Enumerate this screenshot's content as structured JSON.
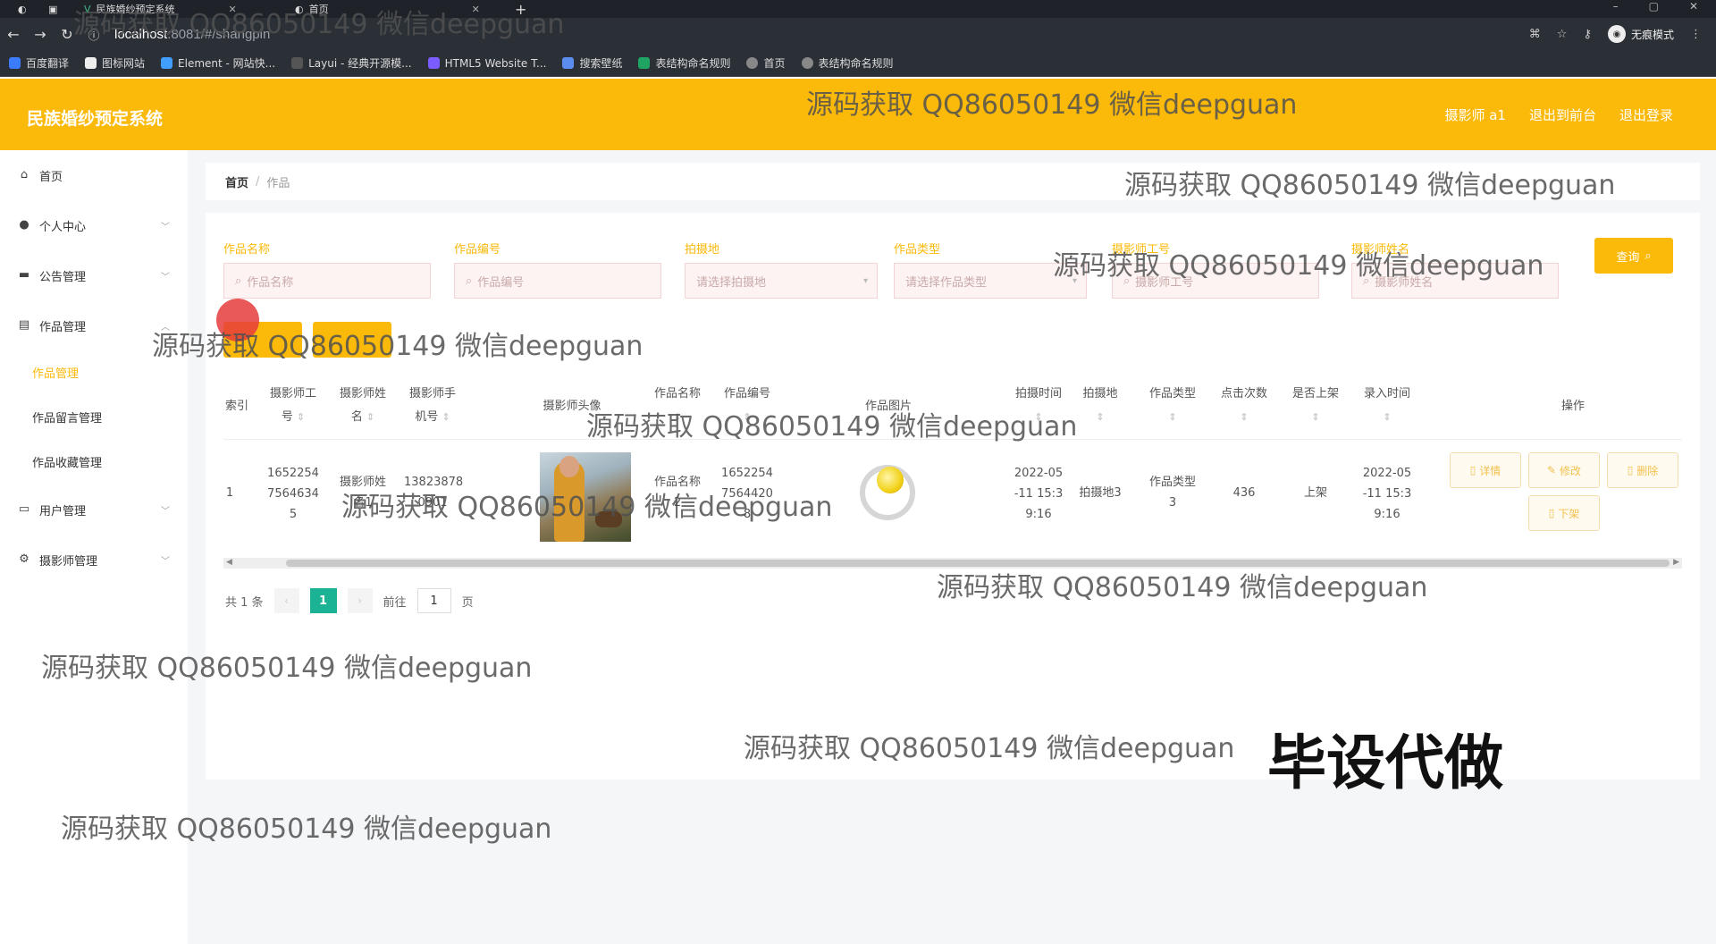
{
  "browser": {
    "tabs": [
      {
        "label": "民族婚纱预定系统"
      },
      {
        "label": "首页"
      }
    ],
    "url_host": "localhost",
    "url_path": ":8081/#/shangpin",
    "incognito_label": "无痕模式",
    "bookmarks": [
      "百度翻译",
      "图标网站",
      "Element - 网站快...",
      "Layui - 经典开源模...",
      "HTML5 Website T...",
      "搜索壁纸",
      "表结构命名规则",
      "首页",
      "表结构命名规则"
    ]
  },
  "header": {
    "title": "民族婚纱预定系统",
    "user": "摄影师 a1",
    "back_front": "退出到前台",
    "logout": "退出登录"
  },
  "sidebar": {
    "home": "首页",
    "personal": "个人中心",
    "notice": "公告管理",
    "works": "作品管理",
    "works_sub": [
      "作品管理",
      "作品留言管理",
      "作品收藏管理"
    ],
    "users": "用户管理",
    "photographers": "摄影师管理"
  },
  "breadcrumb": {
    "home": "首页",
    "sep": "/",
    "current": "作品"
  },
  "filters": {
    "name": {
      "label": "作品名称",
      "placeholder": "作品名称"
    },
    "code": {
      "label": "作品编号",
      "placeholder": "作品编号"
    },
    "location": {
      "label": "拍摄地",
      "placeholder": "请选择拍摄地"
    },
    "type": {
      "label": "作品类型",
      "placeholder": "请选择作品类型"
    },
    "pid": {
      "label": "摄影师工号",
      "placeholder": "摄影师工号"
    },
    "pname": {
      "label": "摄影师姓名",
      "placeholder": "摄影师姓名"
    },
    "search": "查询"
  },
  "table": {
    "headers": {
      "index": "索引",
      "pid": [
        "摄影师工",
        "号"
      ],
      "pname": [
        "摄影师姓",
        "名"
      ],
      "phone": [
        "摄影师手",
        "机号"
      ],
      "avatar": "摄影师头像",
      "wname": "作品名称",
      "wcode": "作品编号",
      "wimg": "作品图片",
      "time": "拍摄时间",
      "loc": "拍摄地",
      "wtype": "作品类型",
      "clicks": "点击次数",
      "onshelf": "是否上架",
      "entry": "录入时间",
      "ops": "操作"
    },
    "row": {
      "index": "1",
      "pid": [
        "1652254",
        "7564634",
        "5"
      ],
      "pname": [
        "摄影师姓",
        "名1"
      ],
      "phone": [
        "13823878",
        "0901"
      ],
      "wname": [
        "作品名称",
        "2"
      ],
      "wcode": [
        "1652254",
        "7564420",
        "8"
      ],
      "time": [
        "2022-05",
        "-11 15:3",
        "9:16"
      ],
      "loc": "拍摄地3",
      "wtype": [
        "作品类型",
        "3"
      ],
      "clicks": "436",
      "onshelf": "上架",
      "entry": [
        "2022-05",
        "-11 15:3",
        "9:16"
      ],
      "ops": {
        "detail": "详情",
        "edit": "修改",
        "delete": "删除",
        "offshelf": "下架"
      }
    }
  },
  "pager": {
    "total": "共 1 条",
    "page": "1",
    "goto": "前往",
    "goto_value": "1",
    "unit": "页"
  },
  "watermarks": {
    "text": "源码获取 QQ86050149 微信deepguan",
    "big": "毕设代做"
  }
}
